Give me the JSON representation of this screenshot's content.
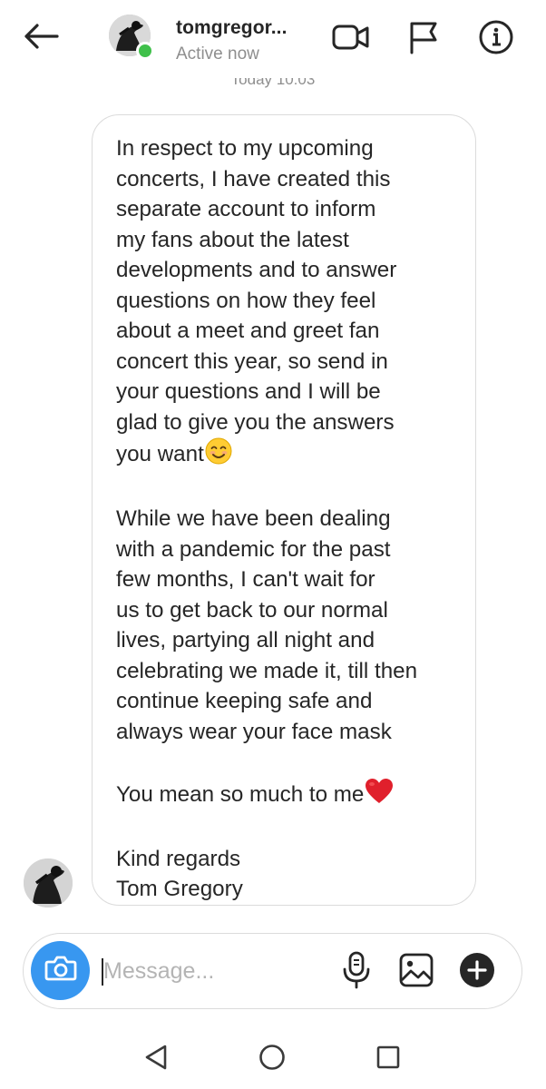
{
  "header": {
    "back_icon": "arrow-left-icon",
    "username": "tomgregor...",
    "status": "Active now",
    "online_color": "#3fc04a",
    "actions": [
      "video-call-icon",
      "flag-icon",
      "info-icon"
    ]
  },
  "timestamp": "Today 10:03",
  "message": {
    "paragraphs": [
      "In respect to my upcoming\nconcerts, I have created this\nseparate account to inform\nmy fans about the latest\ndevelopments and to answer\nquestions on how they feel\nabout a meet and greet fan\nconcert this year, so send in\nyour questions and I will be\nglad to give you the answers\nyou want",
      "While we have been dealing\nwith a pandemic for the past\nfew months, I can't wait for\nus to get back to our normal\nlives, partying all night and\ncelebrating we made it, till then\ncontinue keeping safe and\nalways wear your face mask",
      "You mean so much to me",
      "Kind regards\nTom Gregory"
    ],
    "emojis": [
      "smiling-face-icon",
      "red-heart-icon"
    ]
  },
  "composer": {
    "placeholder": "Message...",
    "value": "",
    "accent_color": "#3897f0",
    "icons": [
      "camera-icon",
      "microphone-icon",
      "gallery-icon",
      "plus-icon"
    ]
  },
  "navbar": {
    "icons": [
      "nav-back-icon",
      "nav-home-icon",
      "nav-recents-icon"
    ]
  }
}
